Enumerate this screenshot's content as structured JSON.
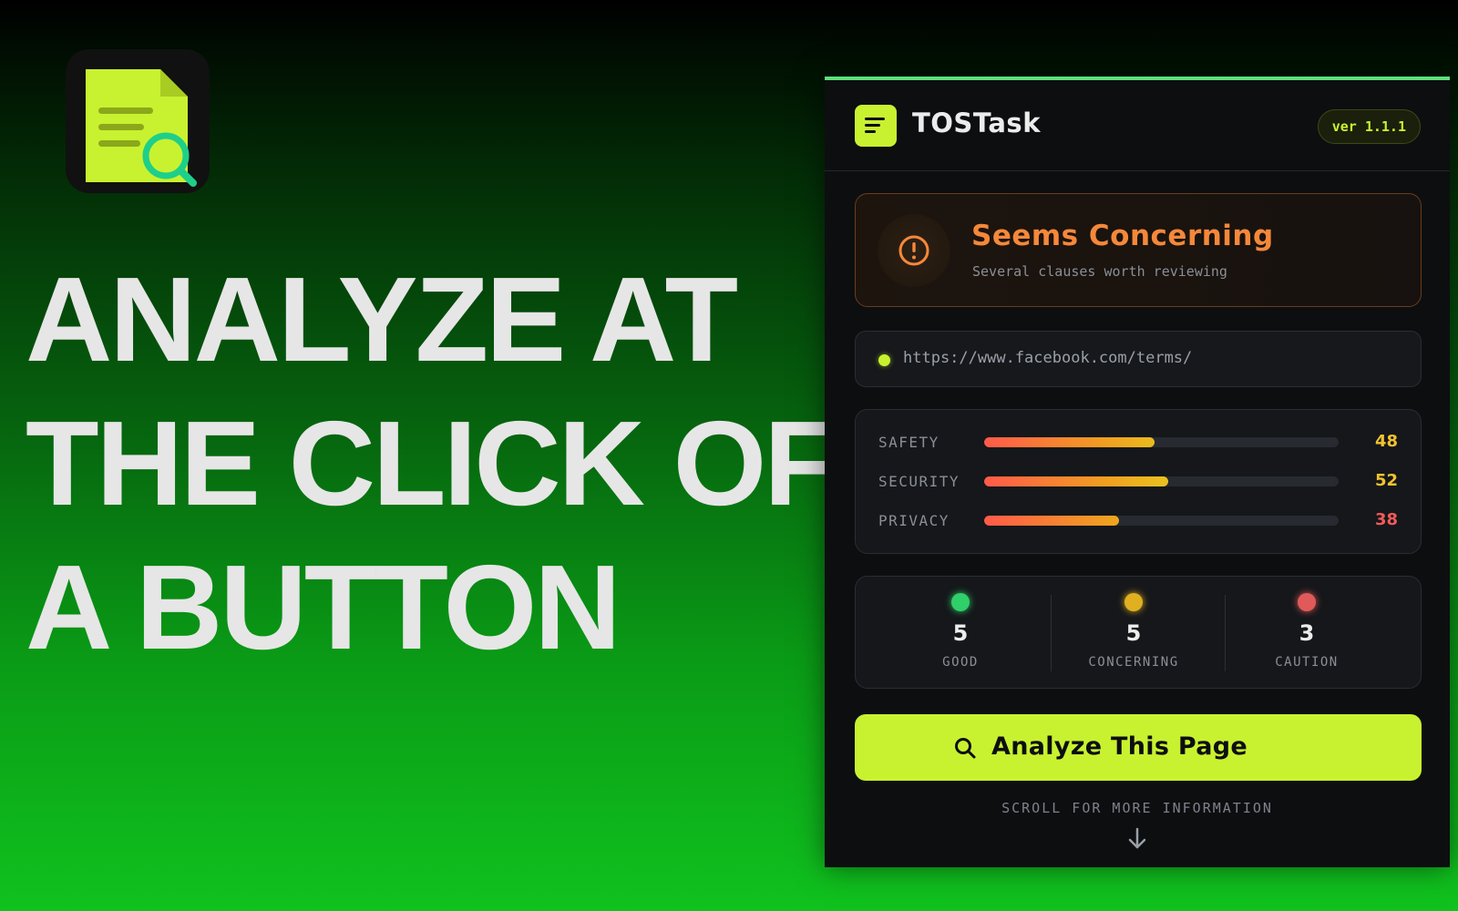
{
  "promo": {
    "headline_lines": [
      "ANALYZE AT",
      "THE CLICK OF",
      "A BUTTON"
    ],
    "app_icon": "document-search-icon"
  },
  "extension": {
    "brand": "TOSTask",
    "version": "ver 1.1.1",
    "accent_color": "#c8f230",
    "status": {
      "title": "Seems Concerning",
      "subtitle": "Several clauses worth reviewing",
      "icon": "alert-circle-icon",
      "color": "#f5883a"
    },
    "url": "https://www.facebook.com/terms/",
    "scores": [
      {
        "label": "SAFETY",
        "value": 48,
        "color": "#f2c230"
      },
      {
        "label": "SECURITY",
        "value": 52,
        "color": "#f2c230"
      },
      {
        "label": "PRIVACY",
        "value": 38,
        "color": "#f05a5a"
      }
    ],
    "counts": [
      {
        "number": "5",
        "label": "GOOD",
        "color": "#2fcf6a"
      },
      {
        "number": "5",
        "label": "CONCERNING",
        "color": "#e0b020"
      },
      {
        "number": "3",
        "label": "CAUTION",
        "color": "#e05a5a"
      }
    ],
    "analyze_button": "Analyze This Page",
    "scroll_hint": "SCROLL FOR MORE INFORMATION"
  }
}
